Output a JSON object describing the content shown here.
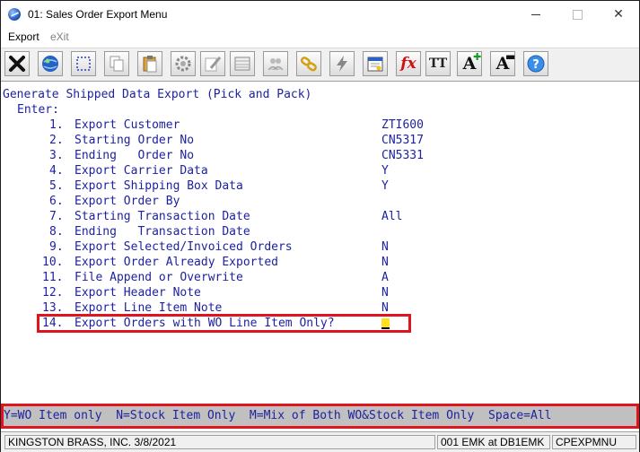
{
  "window": {
    "title": "01: Sales Order Export Menu",
    "close_glyph": "✕"
  },
  "menu": {
    "export": "Export",
    "exit": "eXit"
  },
  "toolbar": {
    "buttons": [
      "close-x-icon",
      "globe-icon",
      "select-box-icon",
      "copy-icon",
      "paste-icon",
      "settings-gear-icon",
      "edit-icon",
      "table-icon",
      "users-icon",
      "chain-link-icon",
      "lightning-icon",
      "calendar-icon",
      "fx-function-icon",
      "font-size-icon",
      "increase-font-icon",
      "decrease-font-icon",
      "help-icon"
    ],
    "fx_label": "fx",
    "tt_label": "TT",
    "a_label": "A",
    "help_label": "?"
  },
  "screen": {
    "heading": "Generate Shipped Data Export (Pick and Pack)",
    "enter_label": "Enter:",
    "fields": [
      {
        "num": "1.",
        "label": "Export Customer",
        "value": "ZTI600"
      },
      {
        "num": "2.",
        "label": "Starting Order No",
        "value": "CN5317"
      },
      {
        "num": "3.",
        "label": "Ending   Order No",
        "value": "CN5331"
      },
      {
        "num": "4.",
        "label": "Export Carrier Data",
        "value": "Y"
      },
      {
        "num": "5.",
        "label": "Export Shipping Box Data",
        "value": "Y"
      },
      {
        "num": "6.",
        "label": "Export Order By",
        "value": ""
      },
      {
        "num": "7.",
        "label": "Starting Transaction Date",
        "value": "All"
      },
      {
        "num": "8.",
        "label": "Ending   Transaction Date",
        "value": ""
      },
      {
        "num": "9.",
        "label": "Export Selected/Invoiced Orders",
        "value": "N"
      },
      {
        "num": "10.",
        "label": "Export Order Already Exported",
        "value": "N"
      },
      {
        "num": "11.",
        "label": "File Append or Overwrite",
        "value": "A"
      },
      {
        "num": "12.",
        "label": "Export Header Note",
        "value": "N"
      },
      {
        "num": "13.",
        "label": "Export Line Item Note",
        "value": "N"
      },
      {
        "num": "14.",
        "label": "Export Orders with WO Line Item Only?",
        "value": ""
      }
    ]
  },
  "help_text": "Y=WO Item only  N=Stock Item Only  M=Mix of Both WO&Stock Item Only  Space=All",
  "status": {
    "company": "KINGSTON BRASS, INC. 3/8/2021",
    "user": "001 EMK at DB1EMK",
    "program": "CPEXPMNU"
  }
}
